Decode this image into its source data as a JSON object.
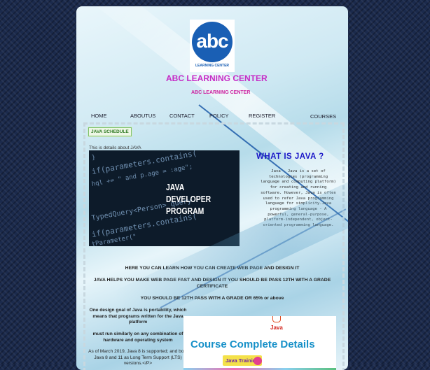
{
  "site": {
    "logo_text": "abc",
    "logo_subtext": "LEARNING CENTER",
    "title": "ABC LEARNING CENTER",
    "subtitle": "ABC LEARNING CENTER"
  },
  "nav": {
    "home": "HOME",
    "aboutus": "ABOUTUS",
    "contact": "CONTACT",
    "policy": "POLICY",
    "register": "REGISTER",
    "courses": "COURSES"
  },
  "section": {
    "badge": "JAVA SCHEDULE",
    "intro": "This is details about JAVA",
    "image_lines": [
      "JAVA",
      "DEVELOPER",
      "PROGRAM"
    ],
    "code_lines": [
      "}",
      "if(parameters.contains(",
      "hql += \" and p.age = :age\";",
      "TypedQuery<Person> query",
      "if(parameters.contains(",
      "tParameter(\""
    ],
    "heading": "WHAT IS JAVA ?",
    "description": "Java - Java is a set of technologies (programming language and computing platform) for creating and running software. However, Java is often used to refer Java programming language for simplicity.Java programming language - A powerful, general-purpose, platform-independent, object-oriented programming language."
  },
  "body": {
    "line1": "HERE YOU CAN LEARN HOW YOU CAN CREATE WEB PAGE AND DESIGN IT",
    "line2": "JAVA HELPS YOU MAKE WEB PAGE FAST AND DESIGN IT YOU SHOULD BE PASS 12TH WITH A GRADE CERTIFICATE",
    "line3": "YOU SHOULD BE 12TH PASS WITH A GRADE OR 65% or above",
    "para1": "One design goal of Java is portability, which means that programs written for the Java platform",
    "para2": "must run similarly on any combination of hardware and operating system",
    "para3": "As of March 2019, Java 8 is supported; and both Java 8 and 11 as Long Term Support (LTS) versions.</P>"
  },
  "course_card": {
    "java_logo": "Java",
    "title": "Course Complete Details",
    "tag": "Java Training"
  }
}
